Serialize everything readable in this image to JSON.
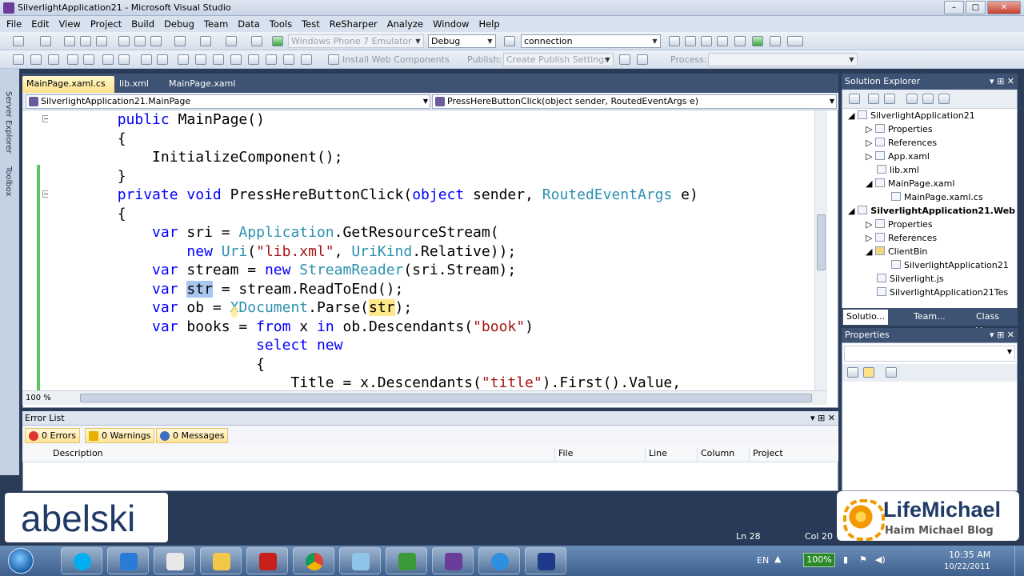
{
  "window": {
    "title": "SilverlightApplication21 - Microsoft Visual Studio",
    "buttons": [
      "–",
      "□",
      "✕"
    ]
  },
  "menu": [
    "File",
    "Edit",
    "View",
    "Project",
    "Build",
    "Debug",
    "Team",
    "Data",
    "Tools",
    "Test",
    "ReSharper",
    "Analyze",
    "Window",
    "Help"
  ],
  "toolbar1": {
    "emulator": "Windows Phone 7 Emulator",
    "config": "Debug",
    "find": "connection"
  },
  "toolbar2": {
    "install": "Install Web Components",
    "publish_label": "Publish:",
    "publish_value": "Create Publish Settings",
    "process_label": "Process:"
  },
  "side_strip": {
    "server_explorer": "Server Explorer",
    "toolbox": "Toolbox"
  },
  "doc_tabs": [
    {
      "label": "MainPage.xaml.cs",
      "active": true
    },
    {
      "label": "lib.xml",
      "active": false
    },
    {
      "label": "MainPage.xaml",
      "active": false
    }
  ],
  "nav": {
    "class_combo": "SilverlightApplication21.MainPage",
    "member_combo": "PressHereButtonClick(object sender, RoutedEventArgs e)"
  },
  "code": {
    "l1": {
      "indent": "        ",
      "kw": "public",
      "rest": " MainPage()"
    },
    "l2": "        {",
    "l3": "            InitializeComponent();",
    "l4": "        }",
    "l5": {
      "indent": "        ",
      "kw1": "private",
      "kw2": "void",
      "mid": " PressHereButtonClick(",
      "kw3": "object",
      "mid2": " sender, ",
      "ty": "RoutedEventArgs",
      "end": " e)"
    },
    "l6": "        {",
    "l7": {
      "indent": "            ",
      "kw": "var",
      "mid": " sri = ",
      "ty": "Application",
      "end": ".GetResourceStream("
    },
    "l8": {
      "indent": "                ",
      "kw": "new",
      "sp": " ",
      "ty": "Uri",
      "p1": "(",
      "st": "\"lib.xml\"",
      "p2": ", ",
      "ty2": "UriKind",
      "end": ".Relative));"
    },
    "l9": {
      "indent": "            ",
      "kw": "var",
      "mid": " stream = ",
      "kw2": "new",
      "sp": " ",
      "ty": "StreamReader",
      "end": "(sri.Stream);"
    },
    "l10": {
      "indent": "            ",
      "kw": "var",
      "sp": " ",
      "hl": "str",
      "end": " = stream.ReadToEnd();"
    },
    "l11": {
      "indent": "            ",
      "kw": "var",
      "mid": " ob = ",
      "ty": "XDocument",
      "mid2": ".Parse(",
      "hl": "str",
      "end": ");"
    },
    "l12": {
      "indent": "            ",
      "kw": "var",
      "mid": " books = ",
      "kw2": "from",
      "mid2": " x ",
      "kw3": "in",
      "mid3": " ob.Descendants(",
      "st": "\"book\"",
      "end": ")"
    },
    "l13": {
      "indent": "                        ",
      "kw": "select",
      "sp": " ",
      "kw2": "new"
    },
    "l14": "                        {",
    "l15": {
      "indent": "                            ",
      "mid": "Title = x.Descendants(",
      "st": "\"title\"",
      "end": ").First().Value,"
    }
  },
  "editor": {
    "zoom": "100 %"
  },
  "error_list": {
    "title": "Error List",
    "errors": "0 Errors",
    "warnings": "0 Warnings",
    "messages": "0 Messages",
    "columns": [
      "Description",
      "File",
      "Line",
      "Column",
      "Project"
    ]
  },
  "solution_explorer": {
    "title": "Solution Explorer",
    "items": [
      {
        "label": "SilverlightApplication21",
        "bold": false
      },
      {
        "label": "Properties",
        "bold": false
      },
      {
        "label": "References",
        "bold": false
      },
      {
        "label": "App.xaml",
        "bold": false
      },
      {
        "label": "lib.xml",
        "bold": false
      },
      {
        "label": "MainPage.xaml",
        "bold": false
      },
      {
        "label": "MainPage.xaml.cs",
        "bold": false
      },
      {
        "label": "SilverlightApplication21.Web",
        "bold": true
      },
      {
        "label": "Properties",
        "bold": false
      },
      {
        "label": "References",
        "bold": false
      },
      {
        "label": "ClientBin",
        "bold": false
      },
      {
        "label": "SilverlightApplication21",
        "bold": false
      },
      {
        "label": "Silverlight.js",
        "bold": false
      },
      {
        "label": "SilverlightApplication21Tes",
        "bold": false
      }
    ],
    "tabs": [
      "Solutio...",
      "Team...",
      "Class V..."
    ]
  },
  "properties": {
    "title": "Properties"
  },
  "status": {
    "ln": "Ln 28",
    "col": "Col 20"
  },
  "watermarks": {
    "left": "abelski",
    "right_name": "LifeMichael",
    "right_sub": "Haim Michael Blog"
  },
  "tray": {
    "lang": "EN",
    "battery": "100%",
    "time": "10:35 AM",
    "date": "10/22/2011"
  },
  "colors": {
    "keyword": "#0000ff",
    "type": "#2b91af",
    "string": "#a31515",
    "accent": "#3e5373"
  }
}
